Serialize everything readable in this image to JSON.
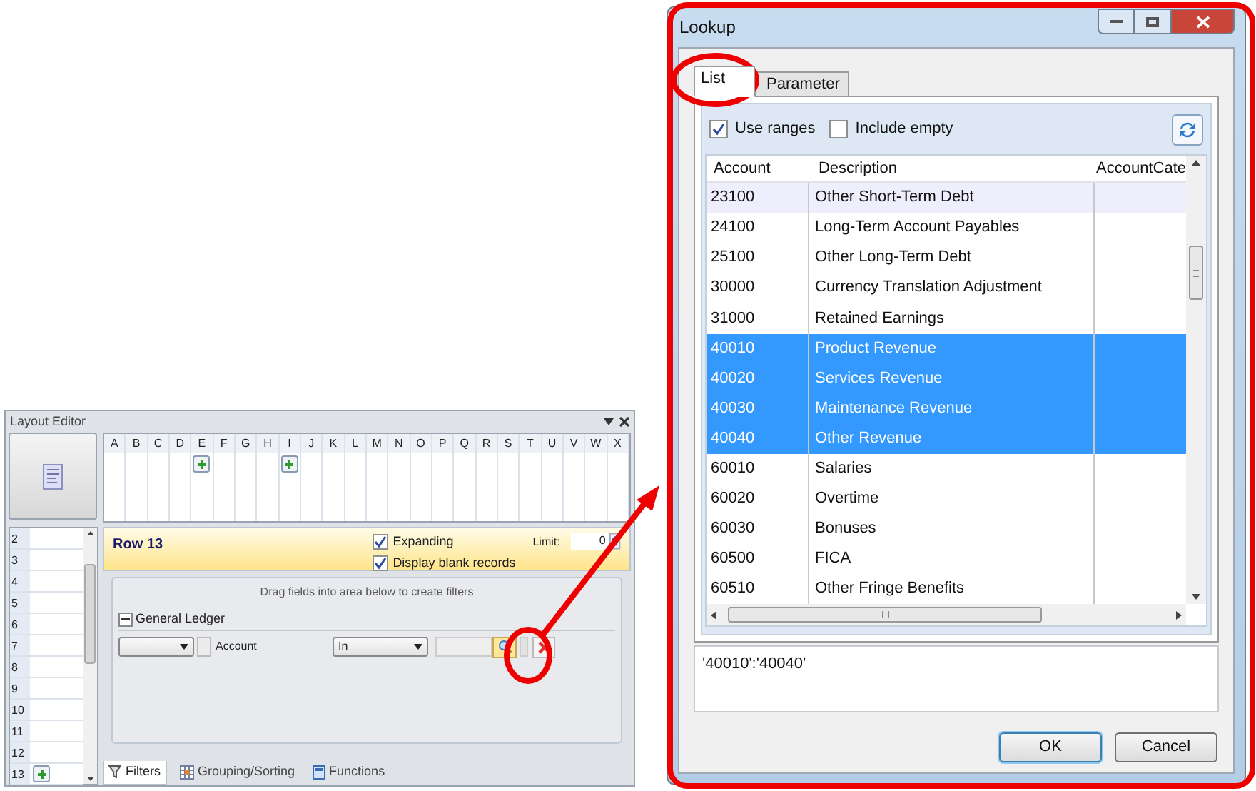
{
  "layout_editor": {
    "title": "Layout Editor",
    "columns": [
      {
        "letter": "A",
        "marker": false
      },
      {
        "letter": "B",
        "marker": false
      },
      {
        "letter": "C",
        "marker": false
      },
      {
        "letter": "D",
        "marker": false
      },
      {
        "letter": "E",
        "marker": true
      },
      {
        "letter": "F",
        "marker": false
      },
      {
        "letter": "G",
        "marker": false
      },
      {
        "letter": "H",
        "marker": false
      },
      {
        "letter": "I",
        "marker": true
      },
      {
        "letter": "J",
        "marker": false
      },
      {
        "letter": "K",
        "marker": false
      },
      {
        "letter": "L",
        "marker": false
      },
      {
        "letter": "M",
        "marker": false
      },
      {
        "letter": "N",
        "marker": false
      },
      {
        "letter": "O",
        "marker": false
      },
      {
        "letter": "P",
        "marker": false
      },
      {
        "letter": "Q",
        "marker": false
      },
      {
        "letter": "R",
        "marker": false
      },
      {
        "letter": "S",
        "marker": false
      },
      {
        "letter": "T",
        "marker": false
      },
      {
        "letter": "U",
        "marker": false
      },
      {
        "letter": "V",
        "marker": false
      },
      {
        "letter": "W",
        "marker": false
      },
      {
        "letter": "X",
        "marker": false
      }
    ],
    "rows": [
      {
        "number": "2",
        "marker": false
      },
      {
        "number": "3",
        "marker": false
      },
      {
        "number": "4",
        "marker": false
      },
      {
        "number": "5",
        "marker": false
      },
      {
        "number": "6",
        "marker": false
      },
      {
        "number": "7",
        "marker": false
      },
      {
        "number": "8",
        "marker": false
      },
      {
        "number": "9",
        "marker": false
      },
      {
        "number": "10",
        "marker": false
      },
      {
        "number": "11",
        "marker": false
      },
      {
        "number": "12",
        "marker": false
      },
      {
        "number": "13",
        "marker": true
      }
    ],
    "row_header": {
      "title": "Row 13",
      "options": [
        {
          "label": "Expanding",
          "checked": true
        },
        {
          "label": "Display blank records",
          "checked": true
        }
      ],
      "limit_label": "Limit:",
      "limit_value": "0"
    },
    "filters": {
      "hint": "Drag fields into area below to create filters",
      "group": "General Ledger",
      "field_checked": false,
      "field_label": "Account",
      "operator": "In"
    },
    "tabs": [
      {
        "label": "Filters",
        "selected": true
      },
      {
        "label": "Grouping/Sorting",
        "selected": false
      },
      {
        "label": "Functions",
        "selected": false
      }
    ]
  },
  "lookup": {
    "title": "Lookup",
    "tabs": [
      {
        "label": "List",
        "selected": true
      },
      {
        "label": "Parameter",
        "selected": false
      }
    ],
    "options": [
      {
        "label": "Use ranges",
        "checked": true
      },
      {
        "label": "Include empty",
        "checked": false
      }
    ],
    "table": {
      "columns": [
        "Account",
        "Description",
        "AccountCate"
      ],
      "rows": [
        {
          "account": "23100",
          "description": "Other Short-Term Debt",
          "selected": false
        },
        {
          "account": "24100",
          "description": "Long-Term Account Payables",
          "selected": false
        },
        {
          "account": "25100",
          "description": "Other Long-Term Debt",
          "selected": false
        },
        {
          "account": "30000",
          "description": "Currency Translation Adjustment",
          "selected": false
        },
        {
          "account": "31000",
          "description": "Retained Earnings",
          "selected": false
        },
        {
          "account": "40010",
          "description": "Product Revenue",
          "selected": true
        },
        {
          "account": "40020",
          "description": "Services Revenue",
          "selected": true
        },
        {
          "account": "40030",
          "description": "Maintenance Revenue",
          "selected": true
        },
        {
          "account": "40040",
          "description": "Other Revenue",
          "selected": true
        },
        {
          "account": "60010",
          "description": "Salaries",
          "selected": false
        },
        {
          "account": "60020",
          "description": "Overtime",
          "selected": false
        },
        {
          "account": "60030",
          "description": "Bonuses",
          "selected": false
        },
        {
          "account": "60500",
          "description": "FICA",
          "selected": false
        },
        {
          "account": "60510",
          "description": "Other Fringe Benefits",
          "selected": false
        }
      ]
    },
    "expression": "'40010':'40040'",
    "buttons": [
      {
        "label": "OK",
        "default": true
      },
      {
        "label": "Cancel",
        "default": false
      }
    ]
  }
}
